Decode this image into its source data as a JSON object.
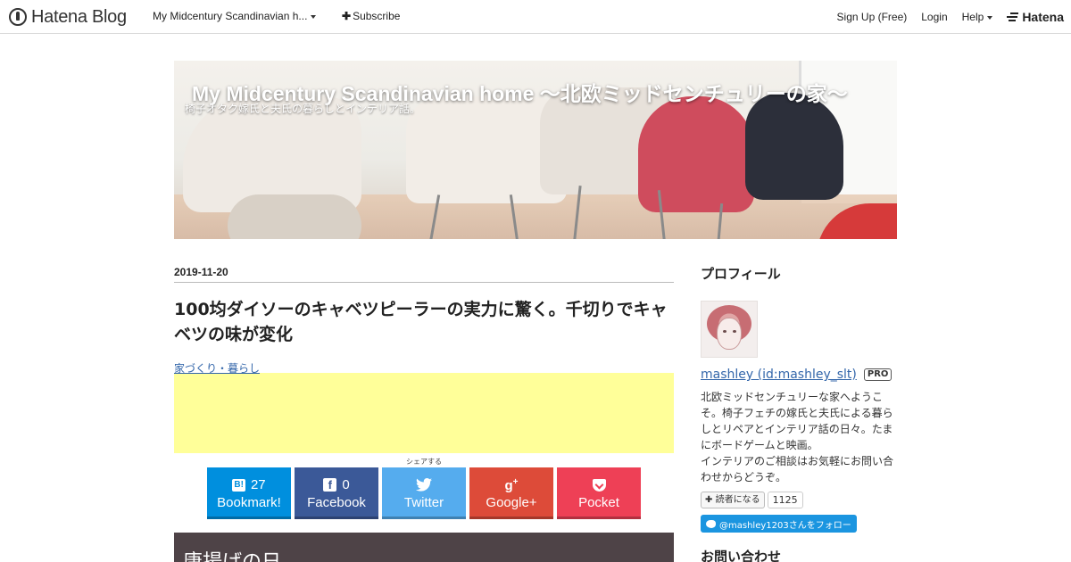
{
  "topbar": {
    "brand": "Hatena Blog",
    "blog_switcher": "My Midcentury Scandinavian h...",
    "subscribe": "Subscribe",
    "signup": "Sign Up (Free)",
    "login": "Login",
    "help": "Help",
    "hatena": "Hatena"
  },
  "header": {
    "title": "My Midcentury Scandinavian home 〜北欧ミッドセンチュリーの家〜",
    "subtitle": "椅子オタク嫁氏と夫氏の暮らしとインテリア話。"
  },
  "entry": {
    "date": "2019-11-20",
    "title": "100均ダイソーのキャベツピーラーの実力に驚く。千切りでキャベツの味が変化",
    "category": "家づくり・暮らし",
    "share_label": "シェアする",
    "share_buttons": [
      {
        "name": "Bookmark!",
        "count": "27",
        "icon": "hatena-bookmark-icon"
      },
      {
        "name": "Facebook",
        "count": "0",
        "icon": "facebook-icon"
      },
      {
        "name": "Twitter",
        "count": "",
        "icon": "twitter-icon"
      },
      {
        "name": "Google+",
        "count": "",
        "icon": "google-plus-icon"
      },
      {
        "name": "Pocket",
        "count": "",
        "icon": "pocket-icon"
      }
    ],
    "section_heading": "唐揚げの日"
  },
  "sidebar": {
    "profile_heading": "プロフィール",
    "user_name": "mashley (id:mashley_slt)",
    "pro_badge": "PRO",
    "description_lines": [
      "北欧ミッドセンチュリーな家へようこそ。椅子フェチの嫁氏と夫氏による暮らしとリペアとインテリア話の日々。たまにボードゲームと映画。",
      "インテリアのご相談はお気軽にお問い合わせからどうぞ。"
    ],
    "reader_button": "読者になる",
    "reader_count": "1125",
    "twitter_follow": "@mashley1203さんをフォロー",
    "next_heading": "お問い合わせ"
  },
  "colors": {
    "hatena_bookmark": "#008fde",
    "facebook": "#3b5998",
    "twitter": "#55acee",
    "google_plus": "#dd4b39",
    "pocket": "#ee4056",
    "ad_background": "#ffff99",
    "section_heading_bg": "#4e4347"
  }
}
